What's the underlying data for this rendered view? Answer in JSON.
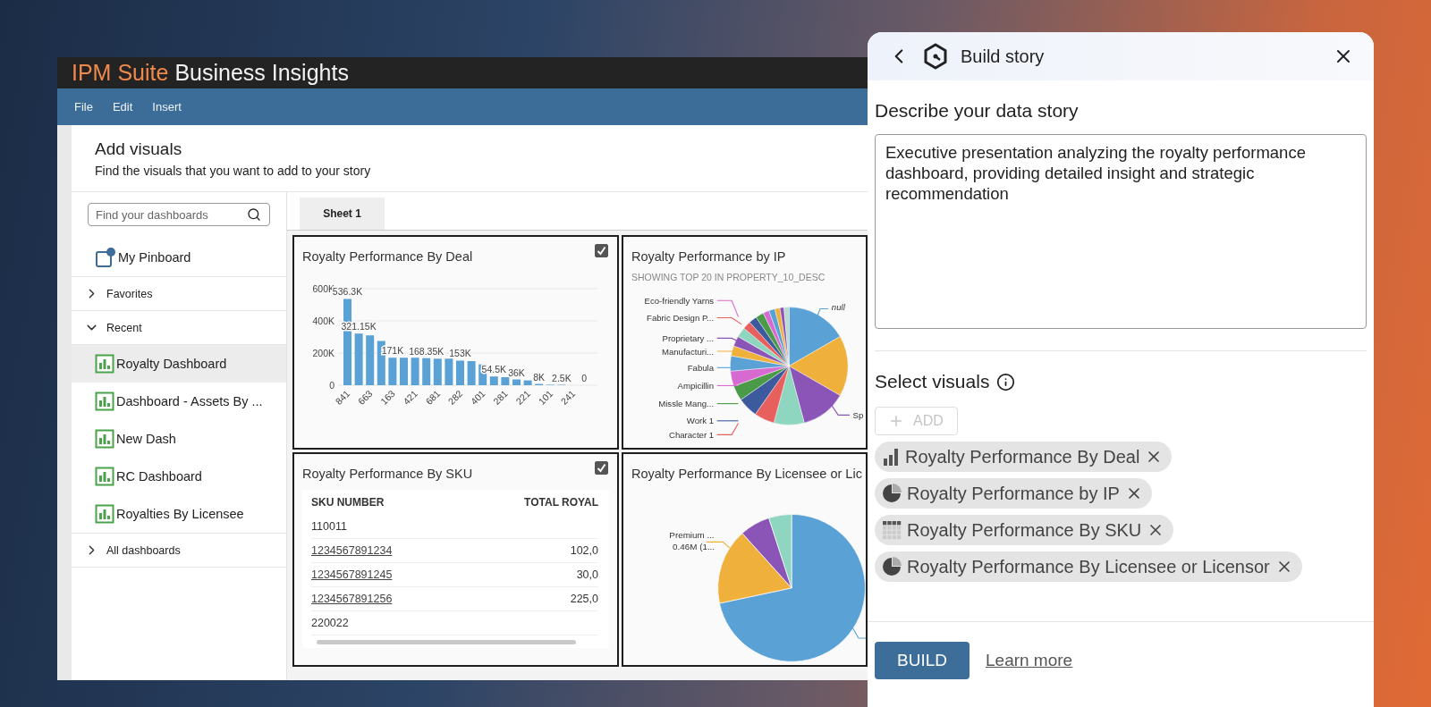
{
  "app": {
    "brand": "IPM Suite",
    "product": "Business Insights",
    "menu": [
      {
        "label": "File"
      },
      {
        "label": "Edit"
      },
      {
        "label": "Insert"
      }
    ]
  },
  "add_visuals": {
    "title": "Add visuals",
    "subtitle": "Find the visuals that you want to add to your story"
  },
  "sidebar": {
    "search": {
      "placeholder": "Find your dashboards"
    },
    "items": [
      {
        "kind": "pinboard",
        "label": "My Pinboard",
        "selected": false
      },
      {
        "kind": "section",
        "label": "Favorites",
        "expanded": false
      },
      {
        "kind": "section",
        "label": "Recent",
        "expanded": true,
        "children": [
          {
            "label": "Royalty Dashboard",
            "selected": true
          },
          {
            "label": "Dashboard - Assets By ...",
            "selected": false
          },
          {
            "label": "New Dash",
            "selected": false
          },
          {
            "label": "RC Dashboard",
            "selected": false
          },
          {
            "label": "Royalties By Licensee",
            "selected": false
          }
        ]
      },
      {
        "kind": "section",
        "label": "All dashboards",
        "expanded": false
      }
    ]
  },
  "sheet_tabs": [
    {
      "label": "Sheet 1",
      "selected": true
    }
  ],
  "visuals": [
    {
      "kind": "bar",
      "title": "Royalty Performance By Deal",
      "checked": true,
      "chart_data": {
        "type": "bar",
        "categories": [
          "841",
          null,
          "663",
          null,
          "163",
          null,
          "421",
          null,
          "681",
          null,
          "282",
          null,
          "401",
          null,
          "281",
          null,
          "221",
          null,
          "101",
          null,
          "241",
          null
        ],
        "values": [
          536300,
          321150,
          310000,
          275000,
          171000,
          171000,
          171000,
          168350,
          165000,
          165000,
          153000,
          150000,
          130000,
          54500,
          50000,
          36000,
          30000,
          8000,
          3000,
          2500,
          null,
          0
        ],
        "value_labels": [
          "536.3K",
          "321.15K",
          null,
          null,
          "171K",
          null,
          null,
          "168.35K",
          null,
          null,
          "153K",
          null,
          null,
          "54.5K",
          null,
          "36K",
          null,
          "8K",
          null,
          "2.5K",
          null,
          "0"
        ],
        "yticks": [
          {
            "value": 0,
            "label": "0"
          },
          {
            "value": 200000,
            "label": "200K"
          },
          {
            "value": 400000,
            "label": "400K"
          },
          {
            "value": 600000,
            "label": "600K"
          }
        ],
        "ylim": [
          0,
          600000
        ]
      }
    },
    {
      "kind": "pie",
      "title": "Royalty Performance by IP",
      "subtitle": "SHOWING TOP 20 IN PROPERTY_10_DESC",
      "left_labels": [
        "Eco-friendly Yarns",
        "Fabric Design P...",
        "Proprietary ...",
        "Manufacturi...",
        "Fabula",
        "Ampicillin",
        "Missle Mang...",
        "Work 1",
        "Character 1"
      ],
      "right_labels": [
        "null",
        "Sp"
      ]
    },
    {
      "kind": "table",
      "title": "Royalty Performance By SKU",
      "checked": true,
      "columns": [
        "SKU NUMBER",
        "TOTAL ROYAL"
      ],
      "rows": [
        {
          "sku": "110011",
          "link": false
        },
        {
          "sku": "1234567891234",
          "link": true,
          "total": "102,0"
        },
        {
          "sku": "1234567891245",
          "link": true,
          "total": "30,0"
        },
        {
          "sku": "1234567891256",
          "link": true,
          "total": "225,0"
        },
        {
          "sku": "220022",
          "link": false
        }
      ]
    },
    {
      "kind": "donut_pie",
      "title": "Royalty Performance By Licensee or Lic",
      "labels": [
        {
          "label": "Premium ...",
          "value": "0.46M (1..."
        }
      ]
    }
  ],
  "story_panel": {
    "title": "Build story",
    "description": {
      "label": "Describe your data story",
      "value": "Executive presentation analyzing the royalty performance dashboard, providing detailed insight and strategic recommendation"
    },
    "select_visuals": {
      "label": "Select visuals",
      "add_button": {
        "label": "ADD",
        "disabled": true
      },
      "chips": [
        {
          "kind": "bar",
          "label": "Royalty Performance By Deal"
        },
        {
          "kind": "pie",
          "label": "Royalty Performance by IP"
        },
        {
          "kind": "table",
          "label": "Royalty Performance By SKU"
        },
        {
          "kind": "pie",
          "label": "Royalty Performance By Licensee or Licensor"
        }
      ]
    },
    "build_button": "BUILD",
    "learn_more": "Learn more"
  }
}
